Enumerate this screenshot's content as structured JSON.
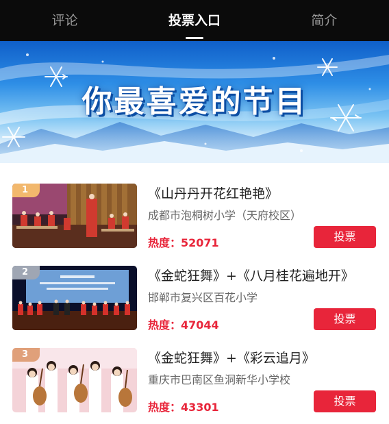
{
  "tabs": [
    {
      "label": "评论",
      "active": false
    },
    {
      "label": "投票入口",
      "active": true
    },
    {
      "label": "简介",
      "active": false
    }
  ],
  "banner": {
    "title": "你最喜爱的节目"
  },
  "items": [
    {
      "rank": "1",
      "title": "《山丹丹开花红艳艳》",
      "school": "成都市泡桐树小学（天府校区）",
      "heat_label": "热度：",
      "heat_value": "52071",
      "vote_label": "投票"
    },
    {
      "rank": "2",
      "title": "《金蛇狂舞》+《八月桂花遍地开》",
      "school": "邯郸市复兴区百花小学",
      "heat_label": "热度：",
      "heat_value": "47044",
      "vote_label": "投票"
    },
    {
      "rank": "3",
      "title": "《金蛇狂舞》+《彩云追月》",
      "school": "重庆市巴南区鱼洞新华小学校",
      "heat_label": "热度：",
      "heat_value": "43301",
      "vote_label": "投票"
    }
  ],
  "colors": {
    "accent": "#e8253a",
    "tabbar_bg": "#0b0b0b",
    "banner_blue": "#1f78d6"
  }
}
